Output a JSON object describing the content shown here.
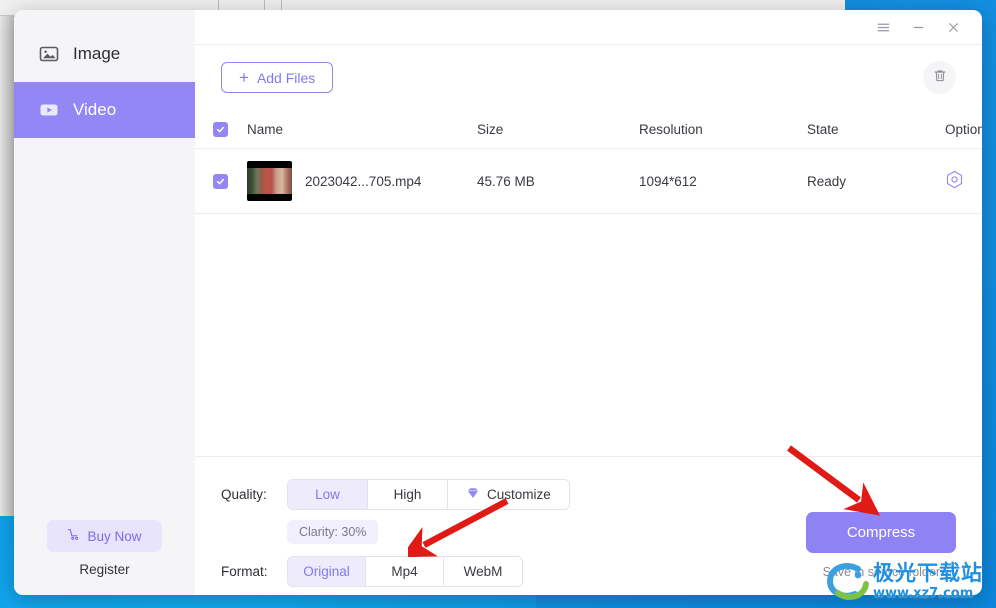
{
  "app": {
    "titlebar": {
      "menu_icon": "hamburger-menu-icon",
      "minimize_icon": "minimize-icon",
      "close_icon": "close-icon"
    }
  },
  "sidebar": {
    "items": [
      {
        "label": "Image",
        "icon": "image-icon",
        "active": false
      },
      {
        "label": "Video",
        "icon": "video-icon",
        "active": true
      }
    ],
    "buy_now_label": "Buy Now",
    "buy_now_icon": "cart-icon",
    "register_label": "Register"
  },
  "toolbar": {
    "add_files_label": "Add Files",
    "add_files_plus": "+",
    "delete_icon": "trash-icon"
  },
  "table": {
    "columns": [
      "Name",
      "Size",
      "Resolution",
      "State",
      "Option"
    ],
    "header_checked": true,
    "rows": [
      {
        "checked": true,
        "name": "2023042...705.mp4",
        "size": "45.76 MB",
        "resolution": "1094*612",
        "state": "Ready",
        "options": [
          "settings-hex-icon",
          "play-icon"
        ]
      }
    ]
  },
  "settings": {
    "quality_label": "Quality:",
    "quality_options": [
      {
        "label": "Low",
        "selected": true
      },
      {
        "label": "High",
        "selected": false
      },
      {
        "label": "Customize",
        "selected": false,
        "icon": "gem-icon"
      }
    ],
    "clarity_tag": "Clarity: 30%",
    "format_label": "Format:",
    "format_options": [
      {
        "label": "Original",
        "selected": true
      },
      {
        "label": "Mp4",
        "selected": false
      },
      {
        "label": "WebM",
        "selected": false
      }
    ],
    "compress_label": "Compress",
    "save_folder_label": "Save in source folder",
    "save_folder_chevron": "chevron-down-icon"
  },
  "annotations": {
    "arrows": [
      {
        "name": "arrow-pointing-to-mp4",
        "target": "Mp4",
        "color": "#e01b15"
      },
      {
        "name": "arrow-pointing-to-compress",
        "target": "Compress",
        "color": "#e01b15"
      }
    ]
  },
  "watermark": {
    "cn_text": "极光下载站",
    "url_text": "www.xz7.com",
    "color": "#1f8fe0"
  },
  "colors": {
    "accent_purple": "#9287f5",
    "accent_purple_light": "#eeebfd",
    "desktop_blue": "#0e9ae6",
    "arrow_red": "#e01b15"
  }
}
